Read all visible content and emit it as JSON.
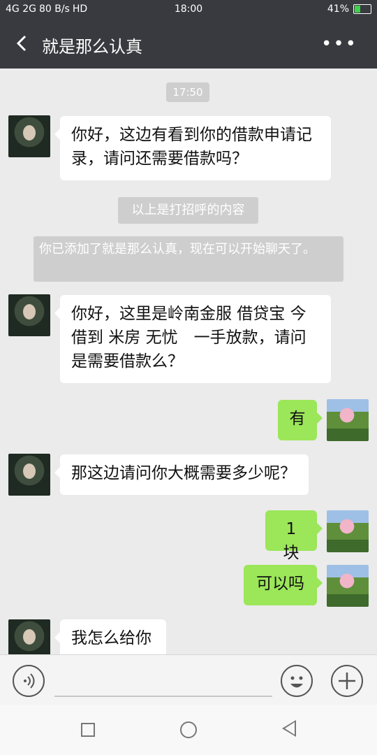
{
  "status": {
    "signal": "4G 2G",
    "speed": "80 B/s",
    "hd": "HD",
    "time": "18:00",
    "battery": "41%",
    "battery_level": 0.41
  },
  "header": {
    "title": "就是那么认真",
    "more": "•••"
  },
  "chat": {
    "timestamp": "17:50",
    "messages": [
      {
        "side": "in",
        "text": "你好，这边有看到你的借款申请记录，请问还需要借款吗？"
      },
      {
        "side": "sys",
        "text": "以上是打招呼的内容"
      },
      {
        "side": "sys",
        "text": "你已添加了就是那么认真，现在可以开始聊天了。"
      },
      {
        "side": "in",
        "text": "你好，这里是岭南金服 借贷宝 今借到 米房 无忧　一手放款，请问是需要借款么？"
      },
      {
        "side": "out",
        "text": "有"
      },
      {
        "side": "in",
        "text": "那这边请问你大概需要多少呢？"
      },
      {
        "side": "out",
        "text": "1 块"
      },
      {
        "side": "out",
        "text": "可以吗"
      },
      {
        "side": "in",
        "text": "我怎么给你"
      }
    ]
  },
  "input": {
    "voice_icon": "voice-icon",
    "emoji_icon": "emoji-icon",
    "plus_icon": "plus-icon"
  },
  "colors": {
    "titlebar": "#393a3f",
    "outgoing_bubble": "#9be659",
    "incoming_bubble": "#ffffff",
    "chat_bg": "#ebebeb"
  }
}
